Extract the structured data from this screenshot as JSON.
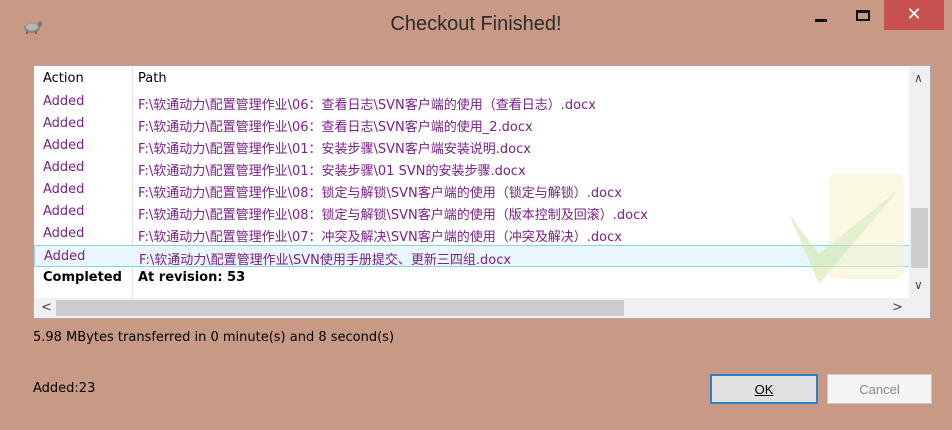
{
  "window": {
    "title": "Checkout Finished!",
    "close_glyph": "✕"
  },
  "list": {
    "headers": {
      "action": "Action",
      "path": "Path"
    },
    "rows": [
      {
        "action": "Added",
        "path": "F:\\软通动力\\配置管理作业\\06：查看日志\\SVN客户端的使用（查看日志）.docx"
      },
      {
        "action": "Added",
        "path": "F:\\软通动力\\配置管理作业\\06：查看日志\\SVN客户端的使用_2.docx"
      },
      {
        "action": "Added",
        "path": "F:\\软通动力\\配置管理作业\\01：安装步骤\\SVN客户端安装说明.docx"
      },
      {
        "action": "Added",
        "path": "F:\\软通动力\\配置管理作业\\01：安装步骤\\01 SVN的安装步骤.docx"
      },
      {
        "action": "Added",
        "path": "F:\\软通动力\\配置管理作业\\08：锁定与解锁\\SVN客户端的使用（锁定与解锁）.docx"
      },
      {
        "action": "Added",
        "path": "F:\\软通动力\\配置管理作业\\08：锁定与解锁\\SVN客户端的使用（版本控制及回滚）.docx"
      },
      {
        "action": "Added",
        "path": "F:\\软通动力\\配置管理作业\\07：冲突及解决\\SVN客户端的使用（冲突及解决）.docx"
      },
      {
        "action": "Added",
        "path": "F:\\软通动力\\配置管理作业\\SVN使用手册提交、更新三四组.docx"
      }
    ],
    "completed": {
      "action": "Completed",
      "path": "At revision: 53"
    }
  },
  "status_text": "5.98 MBytes transferred in 0 minute(s) and 8 second(s)",
  "added_count": "Added:23",
  "buttons": {
    "ok": "OK",
    "cancel": "Cancel"
  },
  "icons": {
    "app": "tortoise-svn-icon",
    "minimize": "minimize-icon",
    "maximize": "maximize-icon",
    "close": "close-icon",
    "scroll_up": "chevron-up-icon",
    "scroll_down": "chevron-down-icon",
    "scroll_left": "chevron-left-icon",
    "scroll_right": "chevron-right-icon"
  },
  "colors": {
    "frame": "#c89a86",
    "close_button": "#c75050",
    "added_text": "#7b1f8a",
    "selection": "#e9f6fb",
    "ok_border": "#2f7fc4"
  }
}
